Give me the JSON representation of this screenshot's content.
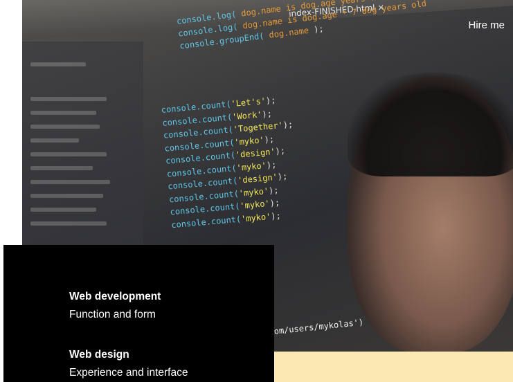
{
  "header": {
    "hire_label": "Hire me"
  },
  "editor": {
    "tab_title": "index-FINISHED.html  ×",
    "top_code": [
      {
        "fn": "console.log(",
        "str": " dog.name  is  dog.age   years old",
        "pl": " );"
      },
      {
        "fn": "console.log(",
        "str": " dog.name  is  dog.age * 7  dog years old",
        "pl": ""
      },
      {
        "fn": "console.groupEnd(",
        "str": " dog.name ",
        "pl": " );"
      }
    ],
    "code_lines": [
      {
        "fn": "console.count(",
        "str": "'Let's'",
        "pl": ");"
      },
      {
        "fn": "console.count(",
        "str": "'Work'",
        "pl": ");"
      },
      {
        "fn": "console.count(",
        "str": "'Together'",
        "pl": ");"
      },
      {
        "fn": "console.count(",
        "str": "'myko'",
        "pl": ");"
      },
      {
        "fn": "console.count(",
        "str": "'design'",
        "pl": ");"
      },
      {
        "fn": "console.count(",
        "str": "'myko'",
        "pl": ");"
      },
      {
        "fn": "console.count(",
        "str": "'design'",
        "pl": ");"
      },
      {
        "fn": "console.count(",
        "str": "'myko'",
        "pl": ");"
      },
      {
        "fn": "console.count(",
        "str": "'myko'",
        "pl": ");"
      },
      {
        "fn": "console.count(",
        "str": "'myko'",
        "pl": ");"
      }
    ],
    "url_fragment": "om/users/mykolas')"
  },
  "services": [
    {
      "title": "Web development",
      "subtitle": "Function and form"
    },
    {
      "title": "Web design",
      "subtitle": "Experience and interface"
    }
  ],
  "colors": {
    "cream": "#fce8b2",
    "panel": "#000000",
    "code_function": "#5fc6e8",
    "code_string": "#f5e85a"
  }
}
